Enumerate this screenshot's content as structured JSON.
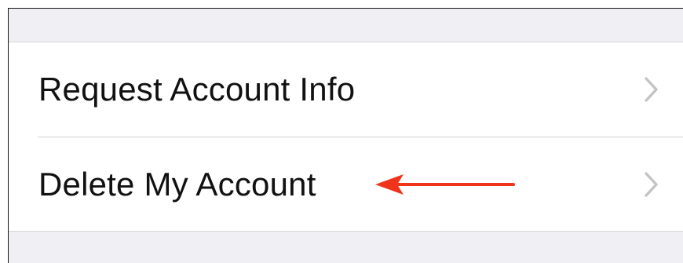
{
  "settings": {
    "rows": [
      {
        "label": "Request Account Info",
        "icon": "chevron-right-icon"
      },
      {
        "label": "Delete My Account",
        "icon": "chevron-right-icon"
      }
    ],
    "annotation": {
      "icon": "red-arrow-left-icon",
      "color": "#f0341c"
    }
  }
}
